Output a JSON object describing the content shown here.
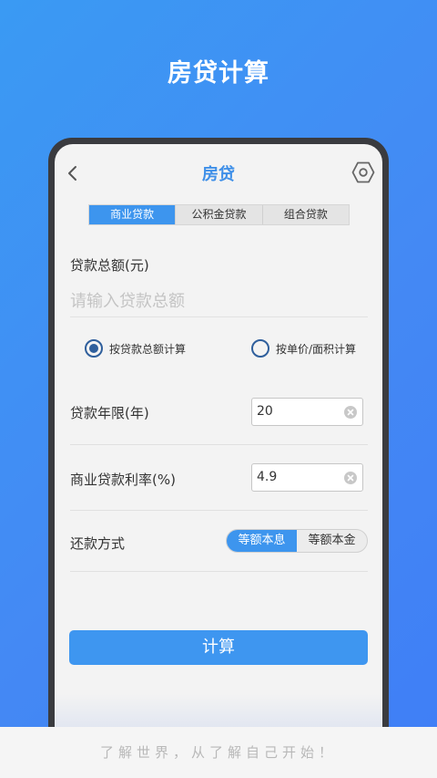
{
  "hero": {
    "title": "房贷计算"
  },
  "nav": {
    "title": "房贷",
    "back_icon": "chevron-left-icon",
    "settings_icon": "hexagon-settings-icon"
  },
  "tabs": [
    {
      "label": "商业贷款",
      "active": true
    },
    {
      "label": "公积金贷款",
      "active": false
    },
    {
      "label": "组合贷款",
      "active": false
    }
  ],
  "form": {
    "amount_label": "贷款总额(元)",
    "amount_placeholder": "请输入贷款总额",
    "amount_value": "",
    "calc_modes": [
      {
        "label": "按贷款总额计算",
        "checked": true
      },
      {
        "label": "按单价/面积计算",
        "checked": false
      }
    ],
    "years_label": "贷款年限(年)",
    "years_value": "20",
    "rate_label": "商业贷款利率(%)",
    "rate_value": "4.9",
    "repay_label": "还款方式",
    "repay_options": [
      {
        "label": "等额本息",
        "active": true
      },
      {
        "label": "等额本金",
        "active": false
      }
    ]
  },
  "calculate_button": "计算",
  "footer": {
    "slogan": "了解世界，从了解自己开始！"
  },
  "colors": {
    "accent": "#3d95ee",
    "nav_title": "#3e8fe8",
    "radio": "#2f5f9c"
  }
}
